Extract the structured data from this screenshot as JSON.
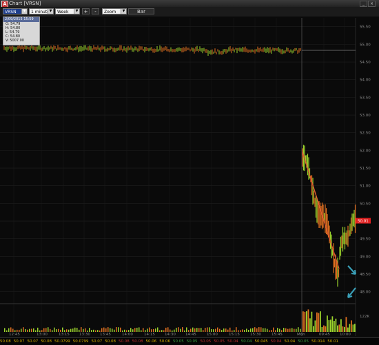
{
  "window": {
    "title": "Chart [VRSN]"
  },
  "toolbar": {
    "symbol": "VRSN",
    "interval": "1 minute",
    "range": "Week",
    "zoom_in": "+",
    "zoom_out": "-",
    "zoom": "Zoom",
    "chart_type": "Bar"
  },
  "ohlc_box": {
    "header": "2/09/2015 15:59",
    "open": "O: 54.79",
    "high": "H: 54.80",
    "low": "L: 54.79",
    "close": "C: 54.80",
    "volume": "V: 5007.00"
  },
  "price_axis": [
    "55.50",
    "55.00",
    "54.50",
    "54.00",
    "53.50",
    "53.00",
    "52.50",
    "52.00",
    "51.50",
    "51.00",
    "50.50",
    "50.00",
    "49.50",
    "49.00",
    "48.50",
    "48.00"
  ],
  "volume_axis": "122K",
  "current_price_tag": "50.01",
  "time_axis": [
    "12:45",
    "13:00",
    "13:15",
    "13:30",
    "13:45",
    "14:00",
    "14:15",
    "14:30",
    "14:45",
    "15:00",
    "15:15",
    "15:30",
    "15:45",
    "Mon",
    "09:45",
    "10:00"
  ],
  "ticker_strip": [
    {
      "t": "50.08",
      "c": "#d8b000"
    },
    {
      "t": "50.07",
      "c": "#d8b000"
    },
    {
      "t": "50.07",
      "c": "#d8b000"
    },
    {
      "t": "50.08",
      "c": "#d8b000"
    },
    {
      "t": "50.0799",
      "c": "#d8b000"
    },
    {
      "t": "50.0799",
      "c": "#d8b000"
    },
    {
      "t": "50.07",
      "c": "#d8b000"
    },
    {
      "t": "50.08",
      "c": "#d8b000"
    },
    {
      "t": "50.08",
      "c": "#c03030"
    },
    {
      "t": "50.08",
      "c": "#c03030"
    },
    {
      "t": "50.06",
      "c": "#d8b000"
    },
    {
      "t": "50.06",
      "c": "#d8b000"
    },
    {
      "t": "50.05",
      "c": "#3aa040"
    },
    {
      "t": "50.05",
      "c": "#3aa040"
    },
    {
      "t": "50.05",
      "c": "#c03030"
    },
    {
      "t": "50.05",
      "c": "#c03030"
    },
    {
      "t": "50.04",
      "c": "#c03030"
    },
    {
      "t": "50.04",
      "c": "#3aa040"
    },
    {
      "t": "50.045",
      "c": "#d8b000"
    },
    {
      "t": "50.04",
      "c": "#c03030"
    },
    {
      "t": "50.04",
      "c": "#d8b000"
    },
    {
      "t": "50.05",
      "c": "#3aa040"
    },
    {
      "t": "50.014",
      "c": "#d8b000"
    },
    {
      "t": "50.01",
      "c": "#d8b000"
    }
  ],
  "colors": {
    "up": "#9bd22c",
    "down": "#e07020",
    "trendline": "#e05a30",
    "arrow": "#3aa0b8",
    "price_tag": "#e02020"
  },
  "chart_data": {
    "type": "bar",
    "ylim": [
      47.8,
      55.65
    ],
    "y_ticks": [
      55.5,
      55.0,
      54.5,
      54.0,
      53.5,
      53.0,
      52.5,
      52.0,
      51.5,
      51.0,
      50.5,
      50.0,
      49.5,
      49.0,
      48.5,
      48.0
    ],
    "volume_max_label": "122K",
    "prior_session": {
      "price_start": 54.9,
      "price_end": 54.82,
      "level_line": 54.83
    },
    "current_session": {
      "open_high": 51.95,
      "low": 48.6,
      "last": 50.01,
      "trendline": {
        "from": 51.95,
        "to": 48.65
      }
    }
  }
}
